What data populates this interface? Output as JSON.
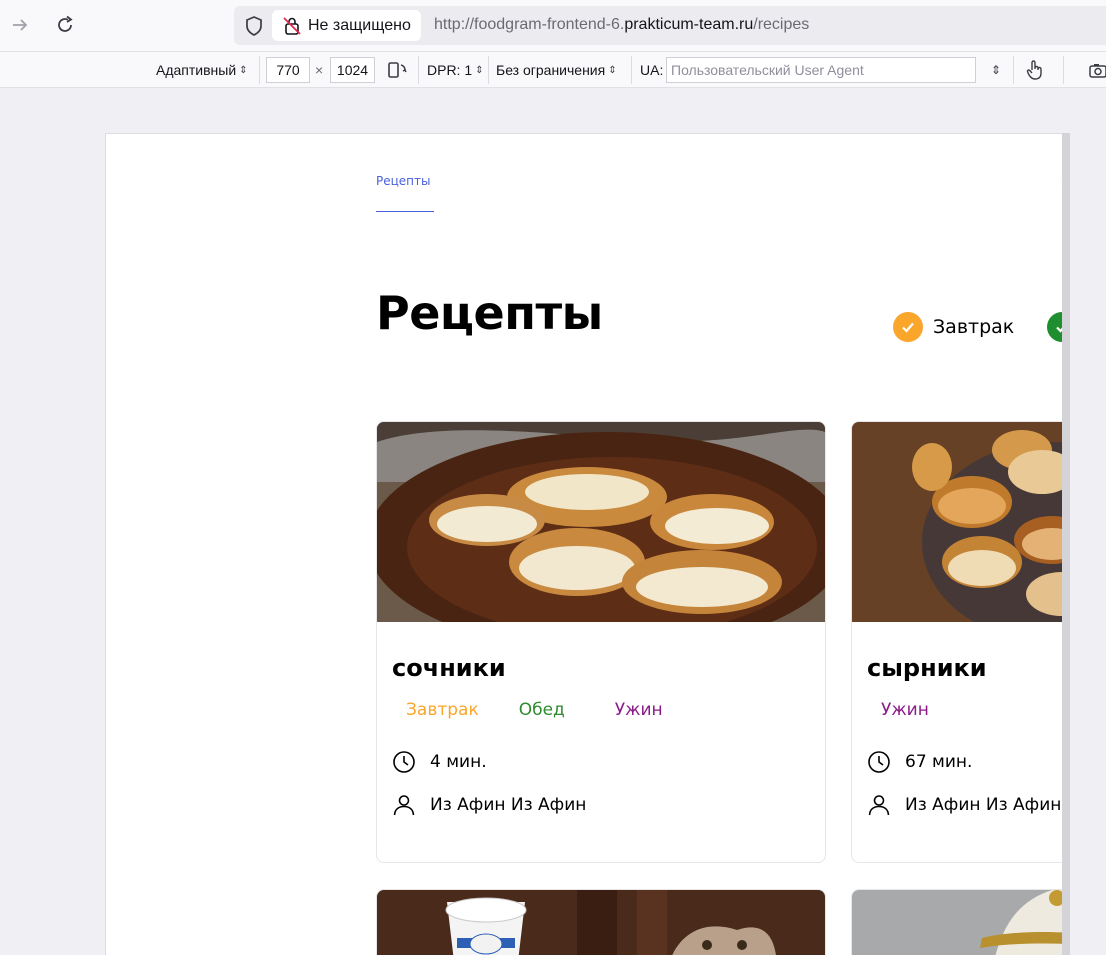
{
  "browser": {
    "security_label": "Не защищено",
    "url_prefix": "http://foodgram-frontend-6.",
    "url_domain": "prakticum-team.ru",
    "url_suffix": "/recipes"
  },
  "responsive": {
    "device": "Адаптивный",
    "width": "770",
    "times": "×",
    "height": "1024",
    "dpr": "DPR: 1",
    "throttle": "Без ограничения",
    "ua_label": "UA:",
    "ua_placeholder": "Пользовательский User Agent"
  },
  "site": {
    "nav_tab": "Рецепты",
    "nav_cut": "Е",
    "page_title": "Рецепты",
    "filters": [
      {
        "label": "Завтрак",
        "color": "#f9a62b"
      },
      {
        "label": "",
        "color": "#49b64e"
      }
    ],
    "cards": [
      {
        "title": "сочники",
        "tags": [
          {
            "label": "Завтрак",
            "color": "#f9a62b"
          },
          {
            "label": "Обед",
            "color": "#2e8b2e"
          },
          {
            "label": "Ужин",
            "color": "#8b1a89"
          }
        ],
        "time": "4 мин.",
        "author": "Из Афин Из Афин"
      },
      {
        "title": "сырники",
        "tags": [
          {
            "label": "Ужин",
            "color": "#8b1a89"
          }
        ],
        "time": "67 мин.",
        "author": "Из Афин Из Афин"
      }
    ]
  }
}
